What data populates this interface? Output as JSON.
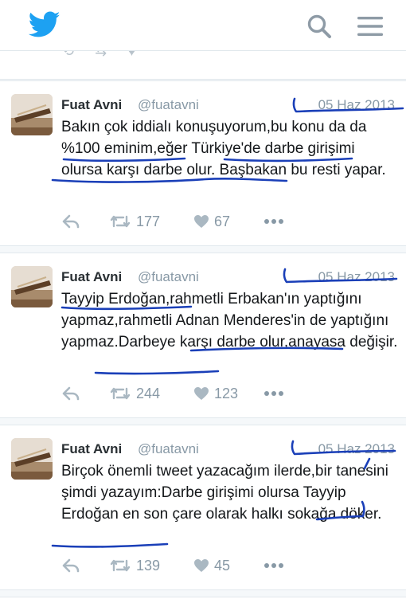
{
  "header": {
    "logo": "twitter-bird-icon",
    "search_icon": "search-icon",
    "menu_icon": "hamburger-menu-icon",
    "brand_color": "#1da1f2"
  },
  "tweets": [
    {
      "author": "Fuat Avni",
      "handle": "@fuatavni",
      "date": "05 Haz 2013",
      "text": "Bakın çok iddialı konuşuyorum,bu konu da da %100 eminim,eğer Türkiye'de darbe girişimi olursa karşı darbe olur. Başbakan bu resti yapar.",
      "retweets": "177",
      "likes": "67"
    },
    {
      "author": "Fuat Avni",
      "handle": "@fuatavni",
      "date": "05 Haz 2013",
      "text": "Tayyip Erdoğan,rahmetli Erbakan'ın yaptığını yapmaz,rahmetli Adnan Menderes'in de yaptığını yapmaz.Darbeye karşı darbe olur,anayasa değişir.",
      "retweets": "244",
      "likes": "123"
    },
    {
      "author": "Fuat Avni",
      "handle": "@fuatavni",
      "date": "05 Haz 2013",
      "text": "Birçok önemli tweet yazacağım ilerde,bir tanesini şimdi yazayım:Darbe girişimi olursa Tayyip Erdoğan en son çare olarak halkı sokağa döker.",
      "retweets": "139",
      "likes": "45"
    }
  ],
  "colors": {
    "annotation_ink": "#1a3fb8",
    "muted": "#8899a6"
  }
}
